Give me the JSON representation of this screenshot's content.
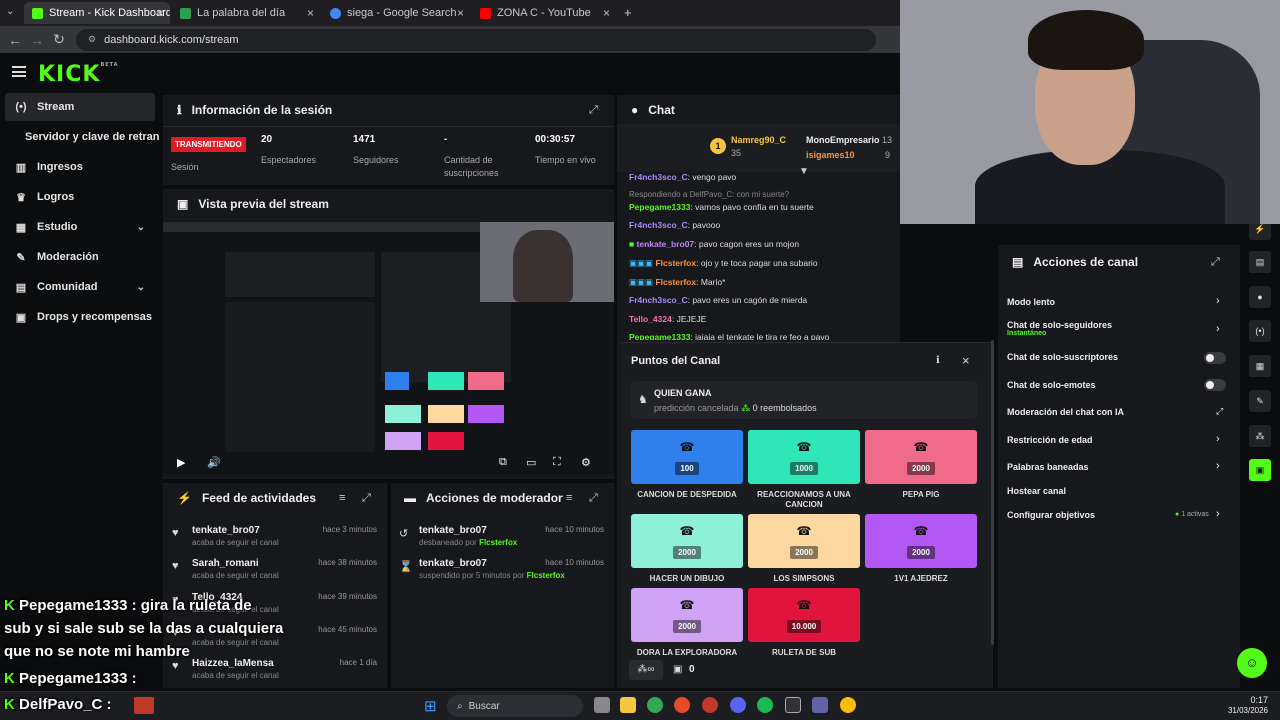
{
  "browser": {
    "tabs": [
      {
        "label": "Stream - Kick Dashboard",
        "color": "#53fc18"
      },
      {
        "label": "La palabra del día",
        "color": "#2e9e4f"
      },
      {
        "label": "siega - Google Search",
        "color": "#4285f4"
      },
      {
        "label": "ZONA C - YouTube",
        "color": "#ff0000"
      }
    ],
    "url": "dashboard.kick.com/stream"
  },
  "logo": "KICK",
  "logo_beta": "BETA",
  "sidebar": {
    "items": [
      {
        "label": "Stream",
        "icon": "(•)"
      },
      {
        "label": "Servidor y clave de retransmisión",
        "icon": ""
      },
      {
        "label": "Ingresos",
        "icon": "▥"
      },
      {
        "label": "Logros",
        "icon": "🏆"
      },
      {
        "label": "Estudio",
        "icon": "▦"
      },
      {
        "label": "Moderación",
        "icon": "🔧"
      },
      {
        "label": "Comunidad",
        "icon": "▤"
      },
      {
        "label": "Drops y recompensas",
        "icon": "▣"
      }
    ]
  },
  "session": {
    "title": "Información de la sesión",
    "status_badge": "TRANSMITIENDO",
    "status_label": "Sesión",
    "stats": [
      {
        "value": "20",
        "label": "Espectadores"
      },
      {
        "value": "1471",
        "label": "Seguidores"
      },
      {
        "value": "-",
        "label": "Cantidad de suscripciones"
      },
      {
        "value": "00:30:57",
        "label": "Tiempo en vivo"
      }
    ]
  },
  "preview": {
    "title": "Vista previa del stream"
  },
  "feed": {
    "title": "Feed de actividades",
    "items": [
      {
        "name": "tenkate_bro07",
        "desc": "acaba de seguir el canal",
        "time": "hace 3 minutos"
      },
      {
        "name": "Sarah_romani",
        "desc": "acaba de seguir el canal",
        "time": "hace 38 minutos"
      },
      {
        "name": "Tello_4324",
        "desc": "acaba de seguir el canal",
        "time": "hace 39 minutos"
      },
      {
        "name": "",
        "desc": "acaba de seguir el canal",
        "time": "hace 45 minutos"
      },
      {
        "name": "Haizzea_laMensa",
        "desc": "acaba de seguir el canal",
        "time": "hace 1 día"
      }
    ]
  },
  "modactions": {
    "title": "Acciones de moderador",
    "items": [
      {
        "name": "tenkate_bro07",
        "desc": "desbaneado por",
        "by": "Flcsterfox",
        "time": "hace 10 minutos"
      },
      {
        "name": "tenkate_bro07",
        "desc": "suspendido por 5 minutos por",
        "by": "Flcsterfox",
        "time": "hace 10 minutos"
      }
    ]
  },
  "chat": {
    "title": "Chat",
    "leaders": [
      {
        "name": "Namreg90_C",
        "n": "35"
      },
      {
        "name": "MonoEmpresario",
        "n": "13"
      },
      {
        "name": "isigames10",
        "n": "9"
      }
    ],
    "lines": [
      {
        "user": "Fr4nch3sco_C",
        "msg": "vengo pavo",
        "color": "#a78bfa"
      },
      {
        "user": "",
        "msg": "Respondiendo a DelfPavo_C: con mi suerte?",
        "color": "#888"
      },
      {
        "user": "Pepegame1333",
        "msg": "vamos pavo confía en tu suerte",
        "color": "#53fc18"
      },
      {
        "user": "Fr4nch3sco_C",
        "msg": "pavooo",
        "color": "#a78bfa"
      },
      {
        "user": "tenkate_bro07",
        "msg": "pavo cagon eres un mojon",
        "color": "#c084fc"
      },
      {
        "user": "Flcsterfox",
        "msg": "ojo y te toca pagar una subario",
        "color": "#fb923c"
      },
      {
        "user": "Flcsterfox",
        "msg": "Mario*",
        "color": "#fb923c"
      },
      {
        "user": "Fr4nch3sco_C",
        "msg": "pavo eres un cagón de mierda",
        "color": "#a78bfa"
      },
      {
        "user": "Tello_4324",
        "msg": "JEJEJE",
        "color": "#f472b6"
      },
      {
        "user": "Pepegame1333",
        "msg": "jajaja el tenkate le tira re feo a pavo",
        "color": "#53fc18"
      }
    ]
  },
  "points": {
    "title": "Puntos del Canal",
    "prediction_title": "QUIEN GANA",
    "prediction_sub": "predicción cancelada",
    "refunded": "0 reembolsados",
    "rewards": [
      {
        "label": "CANCION DE DESPEDIDA",
        "cost": "100",
        "color": "#2f80ed"
      },
      {
        "label": "REACCIONAMOS A UNA CANCION",
        "cost": "1000",
        "color": "#2ee6b8"
      },
      {
        "label": "PEPA PIG",
        "cost": "2000",
        "color": "#f06a8a"
      },
      {
        "label": "HACER UN DIBUJO",
        "cost": "2000",
        "color": "#8ff0da"
      },
      {
        "label": "LOS SIMPSONS",
        "cost": "2000",
        "color": "#fdd9a1"
      },
      {
        "label": "1V1 AJEDREZ",
        "cost": "2000",
        "color": "#b458f5"
      },
      {
        "label": "DORA LA EXPLORADORA",
        "cost": "2000",
        "color": "#cfa2f5"
      },
      {
        "label": "RULETA DE SUB",
        "cost": "10.000",
        "color": "#e0143c"
      }
    ],
    "footer_count": "0"
  },
  "channel": {
    "title": "Acciones de canal",
    "options": [
      {
        "label": "Modo lento",
        "sub": "",
        "kind": "chev"
      },
      {
        "label": "Chat de solo-seguidores",
        "sub": "Instantáneo",
        "kind": "chev"
      },
      {
        "label": "Chat de solo-suscriptores",
        "sub": "",
        "kind": "toggle"
      },
      {
        "label": "Chat de solo-emotes",
        "sub": "",
        "kind": "toggle"
      },
      {
        "label": "Moderación del chat con IA",
        "sub": "",
        "kind": "ext"
      },
      {
        "label": "Restricción de edad",
        "sub": "",
        "kind": "chev"
      },
      {
        "label": "Palabras baneadas",
        "sub": "",
        "kind": "chev"
      },
      {
        "label": "Hostear canal",
        "sub": "",
        "kind": "none"
      },
      {
        "label": "Configurar objetivos",
        "sub": "1 activas",
        "kind": "chev"
      }
    ]
  },
  "overlay": {
    "lines": [
      "Pepegame1333 : gira la ruleta de",
      "sub y si sale sub se la das a cualquiera",
      "que no se note mi hambre",
      "Pepegame1333 :",
      "DelfPavo_C :"
    ]
  },
  "taskbar": {
    "search": "Buscar",
    "time": "0:17",
    "date": "31/03/2026"
  }
}
